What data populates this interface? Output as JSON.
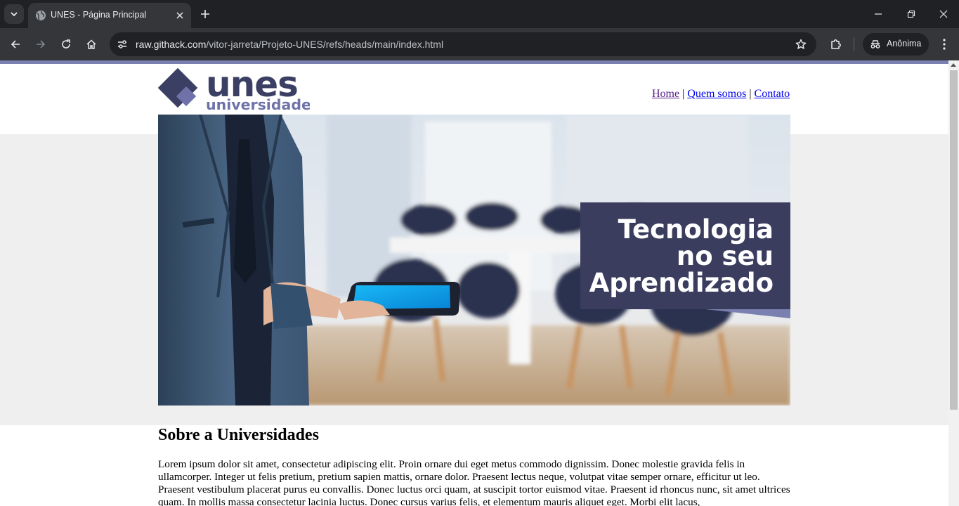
{
  "browser": {
    "tab": {
      "title": "UNES - Página Principal"
    },
    "address_bar": {
      "host": "raw.githack.com",
      "path": "/vitor-jarreta/Projeto-UNES/refs/heads/main/index.html"
    },
    "profile_label": "Anônima"
  },
  "site": {
    "logo": {
      "word": "unes",
      "subword": "universidade",
      "color_dark": "#3b3f63",
      "color_light": "#6e72a8"
    },
    "nav": [
      {
        "label": "Home"
      },
      {
        "label": "Quem somos"
      },
      {
        "label": "Contato"
      }
    ],
    "nav_separator": "|",
    "banner": {
      "lines": [
        "Tecnologia",
        "no seu",
        "Aprendizado"
      ],
      "box_color": "#3a3d5e",
      "accent_color": "#7a80b0"
    },
    "about": {
      "heading": "Sobre a Universidades",
      "body": "Lorem ipsum dolor sit amet, consectetur adipiscing elit. Proin ornare dui eget metus commodo dignissim. Donec molestie gravida felis in ullamcorper. Integer ut felis pretium, pretium sapien mattis, ornare dolor. Praesent lectus neque, volutpat vitae semper ornare, efficitur ut leo. Praesent vestibulum placerat purus eu convallis. Donec luctus orci quam, at suscipit tortor euismod vitae. Praesent id rhoncus nunc, sit amet ultrices quam. In mollis massa consectetur lacinia luctus. Donec cursus varius felis, et elementum mauris aliquet eget. Morbi elit lacus,"
    }
  }
}
